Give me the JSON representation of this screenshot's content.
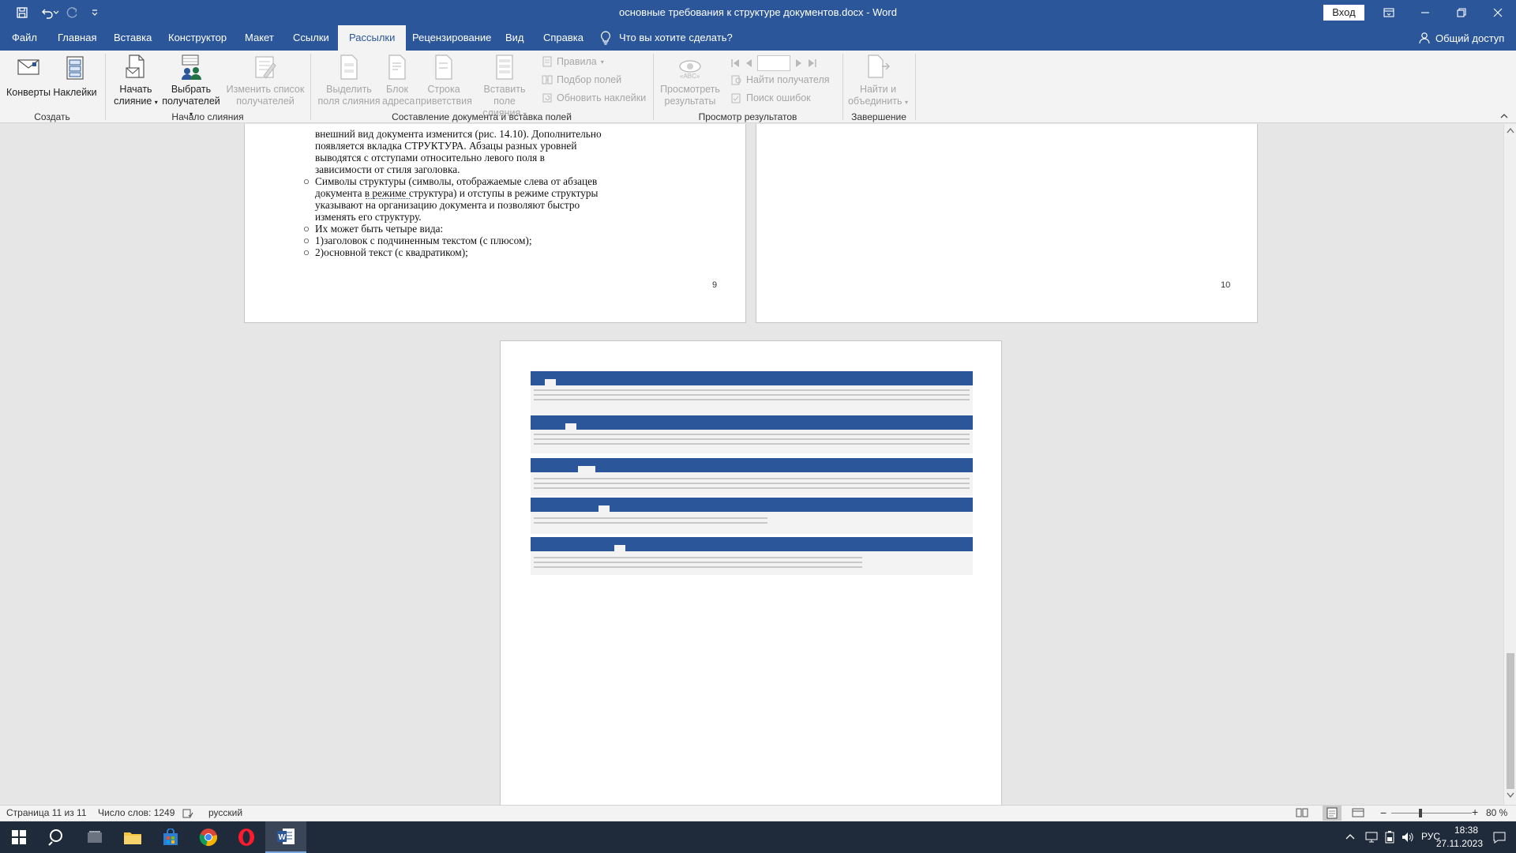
{
  "window": {
    "title": "основные требования к структуре документов.docx - Word",
    "login_label": "Вход"
  },
  "tabs": [
    "Файл",
    "Главная",
    "Вставка",
    "Конструктор",
    "Макет",
    "Ссылки",
    "Рассылки",
    "Рецензирование",
    "Вид",
    "Справка"
  ],
  "active_tab": "Рассылки",
  "tell_me": "Что вы хотите сделать?",
  "share_label": "Общий доступ",
  "ribbon": {
    "groups": {
      "create": "Создать",
      "start_merge": "Начало слияния",
      "write_insert": "Составление документа и вставка полей",
      "preview": "Просмотр результатов",
      "finish": "Завершение"
    },
    "envelopes": "Конверты",
    "labels": "Наклейки",
    "start_merge_l1": "Начать",
    "start_merge_l2": "слияние",
    "select_recipients_l1": "Выбрать",
    "select_recipients_l2": "получателей",
    "edit_list_l1": "Изменить список",
    "edit_list_l2": "получателей",
    "highlight_l1": "Выделить",
    "highlight_l2": "поля слияния",
    "address_l1": "Блок",
    "address_l2": "адреса",
    "greeting_l1": "Строка",
    "greeting_l2": "приветствия",
    "insert_field_l1": "Вставить поле",
    "insert_field_l2": "слияния",
    "rules": "Правила",
    "match_fields": "Подбор полей",
    "update_labels": "Обновить наклейки",
    "preview_l1": "Просмотреть",
    "preview_l2": "результаты",
    "find_recipient": "Найти получателя",
    "check_errors": "Поиск ошибок",
    "finish_l1": "Найти и",
    "finish_l2": "объединить"
  },
  "document": {
    "page9_lines": [
      "внешний вид документа изменится (рис. 14.10). Дополнительно",
      "появляется вкладка СТРУКТУРА. Абзацы разных уровней",
      "выводятся с отступами относительно левого поля в",
      "зависимости от стиля заголовка."
    ],
    "page9_bullet1": [
      "Символы структуры (символы, отображаемые слева от абзацев",
      "документа в режиме структура) и отступы в режиме структуры",
      "указывают на организацию документа и позволяют быстро",
      "изменять его структуру."
    ],
    "page9_bullet2": "Их может быть четыре вида:",
    "page9_bullet3": "1)заголовок с подчиненным текстом (с плюсом);",
    "page9_bullet4": "2)основной текст (с квадратиком);",
    "page9_number": "9",
    "page10_number": "10"
  },
  "status": {
    "page": "Страница 11 из 11",
    "words": "Число слов: 1249",
    "language": "русский",
    "zoom": "80 %"
  },
  "taskbar": {
    "language": "РУС",
    "time": "18:38",
    "date": "27.11.2023"
  },
  "colors": {
    "word_blue": "#2b579a",
    "ribbon_bg": "#f3f3f3",
    "taskbar_bg": "#1f2a3a"
  }
}
